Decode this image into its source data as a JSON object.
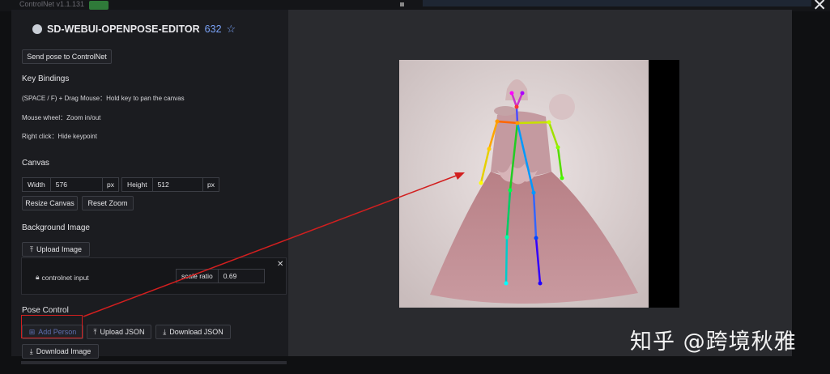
{
  "window": {
    "top_label": "ControlNet v1.1.131",
    "close": "✕"
  },
  "editor": {
    "title": "SD-WEBUI-OPENPOSE-EDITOR",
    "stars": "632",
    "star_icon": "☆"
  },
  "actions": {
    "send_pose": "Send pose to ControlNet"
  },
  "key_bindings": {
    "heading": "Key Bindings",
    "lines": [
      "(SPACE / F) + Drag Mouse：Hold key to pan the canvas",
      "Mouse wheel：Zoom in/out",
      "Right click：Hide keypoint"
    ]
  },
  "canvas": {
    "heading": "Canvas",
    "width_label": "Width",
    "width_value": "576",
    "width_unit": "px",
    "height_label": "Height",
    "height_value": "512",
    "height_unit": "px",
    "resize_button": "Resize Canvas",
    "reset_zoom_button": "Reset Zoom"
  },
  "background": {
    "heading": "Background Image",
    "upload_button": "Upload Image",
    "item_label": "controlnet input",
    "scale_label": "scale ratio",
    "scale_value": "0.69",
    "close": "✕"
  },
  "pose": {
    "heading": "Pose Control",
    "add_person": "Add Person",
    "upload_json": "Upload JSON",
    "download_json": "Download JSON",
    "download_image": "Download Image"
  },
  "watermark": "知乎 @跨境秋雅",
  "colors": {
    "highlight": "#d21f1f",
    "star": "#7aa2f7",
    "panel": "#1b1c20"
  }
}
